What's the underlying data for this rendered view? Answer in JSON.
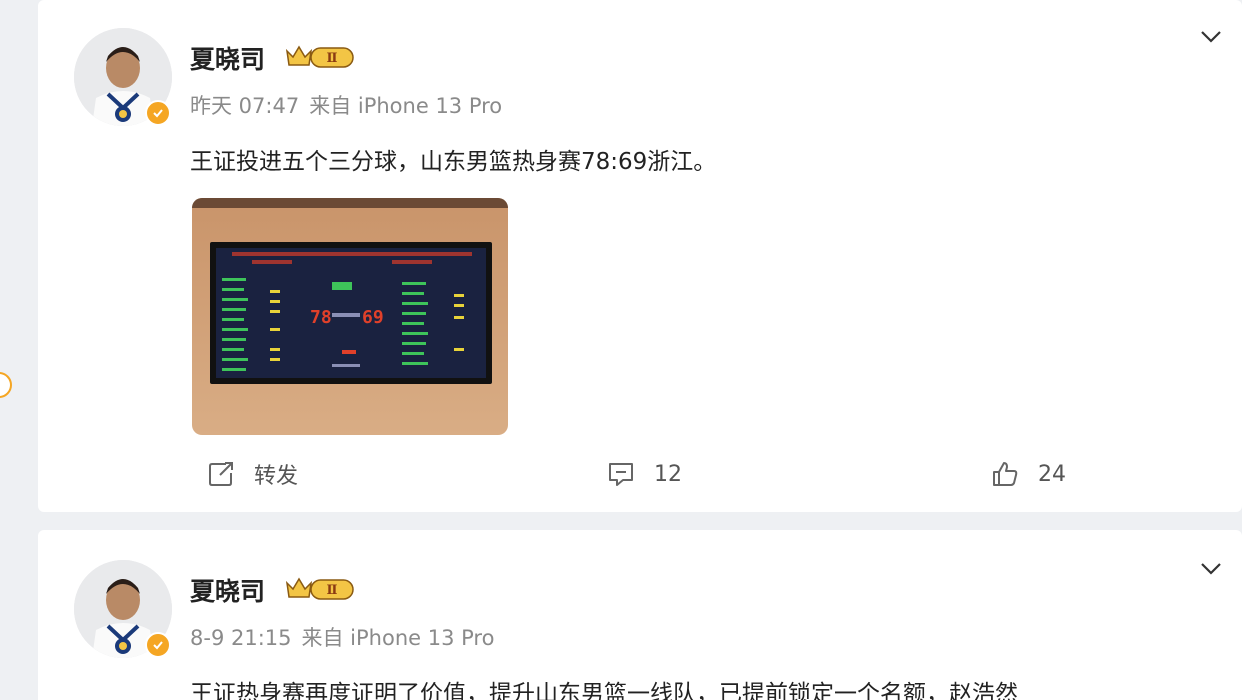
{
  "colors": {
    "background": "#eef0f3",
    "card": "#ffffff",
    "verified": "#f5a623",
    "meta_text": "#8a8a8a",
    "badge_gold": "#f3c545"
  },
  "posts": [
    {
      "author": "夏晓司",
      "member_badge_level": "Ⅱ",
      "time": "昨天 07:47",
      "source": "来自 iPhone 13 Pro",
      "text": "王证投进五个三分球，山东男篮热身赛78:69浙江。",
      "photo_icon": "scoreboard-photo",
      "actions": {
        "repost_label": "转发",
        "comment_count": "12",
        "like_count": "24"
      }
    },
    {
      "author": "夏晓司",
      "member_badge_level": "Ⅱ",
      "time": "8-9 21:15",
      "source": "来自 iPhone 13 Pro",
      "text": "王证热身赛再度证明了价值，提升山东男篮一线队，已提前锁定一个名额，赵浩然"
    }
  ]
}
